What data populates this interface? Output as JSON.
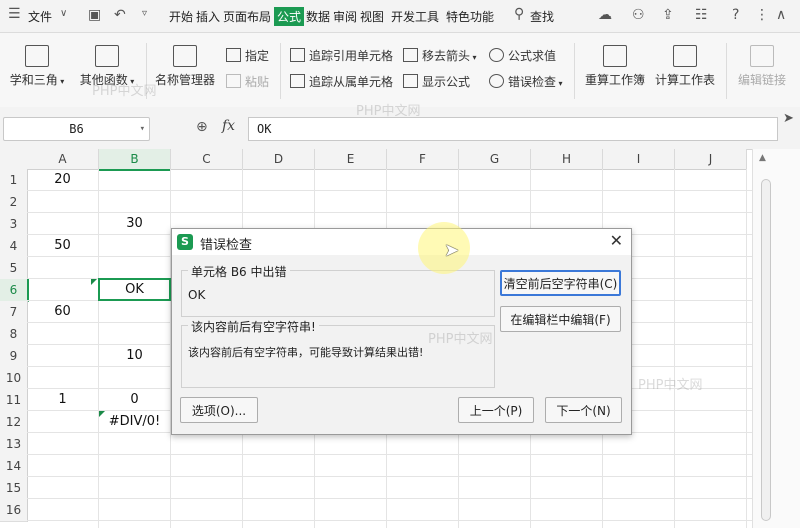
{
  "menubar": {
    "file_label": "文件",
    "tabs": [
      {
        "label": "开始",
        "active": false
      },
      {
        "label": "插入",
        "active": false
      },
      {
        "label": "页面布局",
        "active": false
      },
      {
        "label": "公式",
        "active": true
      },
      {
        "label": "数据",
        "active": false
      },
      {
        "label": "审阅",
        "active": false
      },
      {
        "label": "视图",
        "active": false
      },
      {
        "label": "开发工具",
        "active": false
      },
      {
        "label": "特色功能",
        "active": false
      }
    ],
    "search_label": "查找"
  },
  "ribbon": {
    "math_trig": "学和三角",
    "other_funcs": "其他函数",
    "name_manager": "名称管理器",
    "define": "指定",
    "paste": "粘贴",
    "trace_precedents": "追踪引用单元格",
    "trace_dependents": "追踪从属单元格",
    "remove_arrows": "移去箭头",
    "show_formulas": "显示公式",
    "evaluate": "公式求值",
    "error_check": "错误检查",
    "recalc_workbook": "重算工作簿",
    "calc_sheet": "计算工作表",
    "edit_links": "编辑链接"
  },
  "formula_bar": {
    "name_box": "B6",
    "fx_label": "fx",
    "value": "OK"
  },
  "grid": {
    "columns": [
      "A",
      "B",
      "C",
      "D",
      "E",
      "F",
      "G",
      "H",
      "I",
      "J"
    ],
    "rows": [
      "1",
      "2",
      "3",
      "4",
      "5",
      "6",
      "7",
      "8",
      "9",
      "10",
      "11",
      "12",
      "13",
      "14",
      "15",
      "16"
    ],
    "selected_col": "B",
    "selected_row": "6",
    "cells": {
      "A1": "20",
      "B3": "30",
      "A4": "50",
      "B6": "OK",
      "A7": "60",
      "B9": "10",
      "A11": "1",
      "B11": "0",
      "B12": "#DIV/0!"
    }
  },
  "dialog": {
    "title": "错误检查",
    "cell_error_label": "单元格 B6 中出错",
    "cell_value": "OK",
    "issue_title": "该内容前后有空字符串!",
    "issue_detail": "该内容前后有空字符串，可能导致计算结果出错!",
    "trim_button": "清空前后空字符串(C)",
    "edit_in_bar_button": "在编辑栏中编辑(F)",
    "options_button": "选项(O)...",
    "prev_button": "上一个(P)",
    "next_button": "下一个(N)"
  },
  "watermark": "PHP中文网",
  "colors": {
    "accent": "#1b9a52",
    "primary_button_border": "#3b78d8"
  }
}
